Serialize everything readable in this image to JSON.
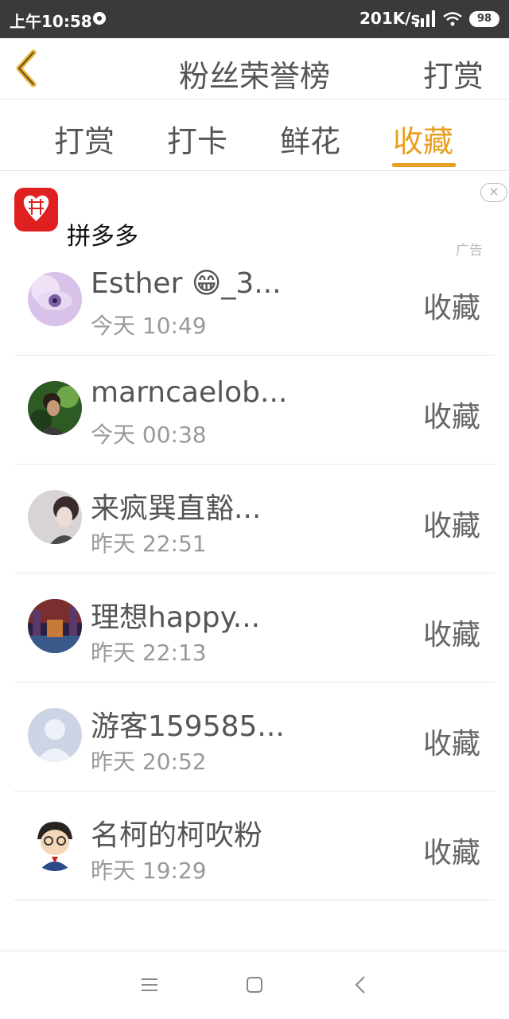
{
  "status_bar": {
    "time": "上午10:58",
    "network_speed": "201K/s",
    "battery": "98"
  },
  "title_bar": {
    "title": "粉丝荣誉榜",
    "action": "打赏"
  },
  "tabs": [
    {
      "label": "打赏",
      "active": false
    },
    {
      "label": "打卡",
      "active": false
    },
    {
      "label": "鲜花",
      "active": false
    },
    {
      "label": "收藏",
      "active": true
    }
  ],
  "ad": {
    "name": "拼多多",
    "label": "广告",
    "close": "×"
  },
  "rows": [
    {
      "name": "Esther 😁_3...",
      "time": "今天 10:49",
      "action": "收藏"
    },
    {
      "name": "marncaelob...",
      "time": "今天 00:38",
      "action": "收藏"
    },
    {
      "name": "来疯巽直豁...",
      "time": "昨天 22:51",
      "action": "收藏"
    },
    {
      "name": "理想happy...",
      "time": "昨天 22:13",
      "action": "收藏"
    },
    {
      "name": "游客159585...",
      "time": "昨天 20:52",
      "action": "收藏"
    },
    {
      "name": "名柯的柯吹粉",
      "time": "昨天 19:29",
      "action": "收藏"
    }
  ],
  "colors": {
    "accent": "#e8a020",
    "status_bar": "#3a3a3a",
    "divider": "#e6e6e6"
  }
}
